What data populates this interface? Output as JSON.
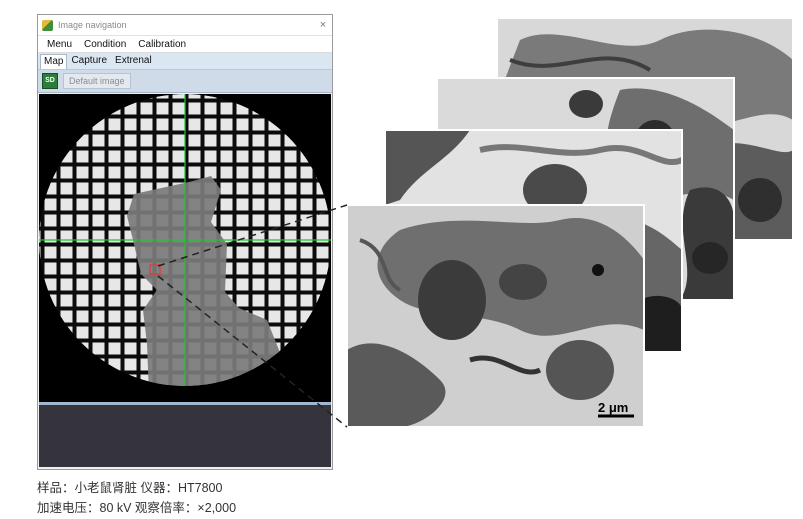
{
  "window": {
    "title": "Image navigation",
    "close_icon": "close-icon",
    "menu": [
      "Menu",
      "Condition",
      "Calibration"
    ],
    "tabs": [
      "Map",
      "Capture",
      "Extrenal"
    ],
    "active_tab": "Map",
    "toolbar": {
      "save_icon": "save-icon",
      "default_image_label": "Default image"
    }
  },
  "micrograph": {
    "scale_bar_label": "2 μm"
  },
  "caption": {
    "line1": "样品：小老鼠肾脏 仪器：HT7800",
    "line2": "加速电压：80 kV 观察倍率：×2,000"
  },
  "colors": {
    "crosshair": "#19c72a",
    "selection": "#e23b3b",
    "toolbar_bg": "#cfdbe8",
    "tab_bar_bg": "#dbe6f3",
    "bottom_panel": "#35333b"
  }
}
